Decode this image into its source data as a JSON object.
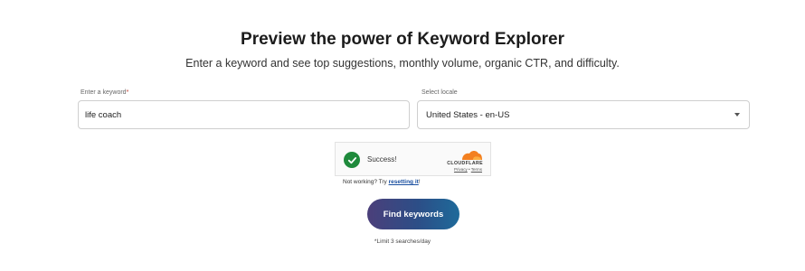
{
  "header": {
    "title": "Preview the power of Keyword Explorer",
    "subtitle": "Enter a keyword and see top suggestions, monthly volume, organic CTR, and difficulty."
  },
  "form": {
    "keyword": {
      "label": "Enter a keyword",
      "required_marker": "*",
      "value": "life coach"
    },
    "locale": {
      "label": "Select locale",
      "selected": "United States - en-US"
    }
  },
  "captcha": {
    "status": "Success!",
    "brand": "CLOUDFLARE",
    "privacy_link": "Privacy",
    "separator": "•",
    "terms_link": "Terms",
    "check_color": "#1f8a3c",
    "brand_color": "#f38020"
  },
  "help": {
    "prefix": "Not working? Try ",
    "link": "resetting it",
    "suffix": "!"
  },
  "actions": {
    "find_label": "Find keywords",
    "limit_note": "*Limit 3 searches/day"
  }
}
